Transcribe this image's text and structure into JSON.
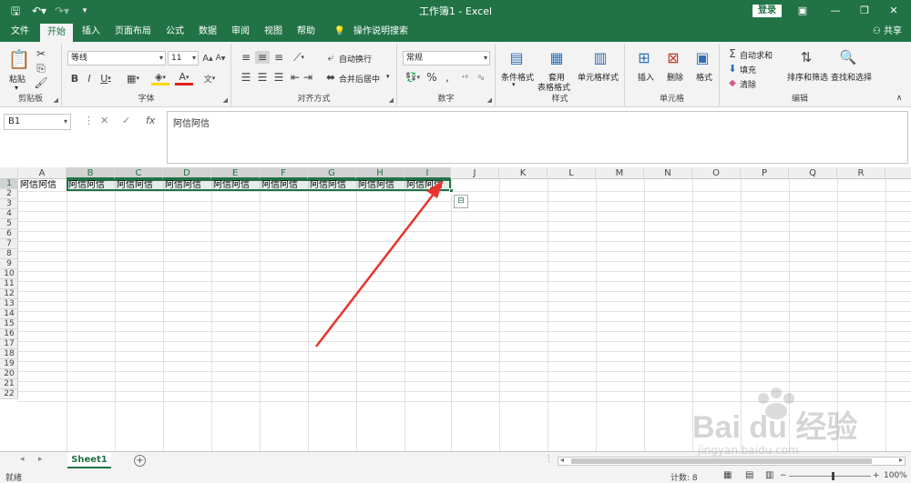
{
  "window": {
    "title": "工作簿1  -  Excel",
    "login_label": "登录"
  },
  "menu": {
    "tabs": [
      "文件",
      "开始",
      "插入",
      "页面布局",
      "公式",
      "数据",
      "审阅",
      "视图",
      "帮助"
    ],
    "tell_me": "操作说明搜索",
    "share": "共享"
  },
  "ribbon": {
    "clipboard": {
      "label": "剪贴板",
      "paste": "粘贴"
    },
    "font": {
      "label": "字体",
      "font_name": "等线",
      "font_size": "11"
    },
    "alignment": {
      "label": "对齐方式",
      "wrap": "自动换行",
      "merge": "合并后居中"
    },
    "number": {
      "label": "数字",
      "format": "常规"
    },
    "styles": {
      "label": "样式",
      "conditional": "条件格式",
      "table_line1": "套用",
      "table_line2": "表格格式",
      "cell_styles": "单元格样式"
    },
    "cells": {
      "label": "单元格",
      "insert": "插入",
      "delete": "删除",
      "format": "格式"
    },
    "editing": {
      "label": "编辑",
      "autosum": "自动求和",
      "fill": "填充",
      "clear": "清除",
      "sort": "排序和筛选",
      "find": "查找和选择"
    }
  },
  "formula_bar": {
    "name_box": "B1",
    "formula": "阿信阿信"
  },
  "grid": {
    "columns": [
      "A",
      "B",
      "C",
      "D",
      "E",
      "F",
      "G",
      "H",
      "I",
      "J",
      "K",
      "L",
      "M",
      "N",
      "O",
      "P",
      "Q",
      "R"
    ],
    "rows": [
      "1",
      "2",
      "3",
      "4",
      "5",
      "6",
      "7",
      "8",
      "9",
      "10",
      "11",
      "12",
      "13",
      "14",
      "15",
      "16",
      "17",
      "18",
      "19",
      "20",
      "21",
      "22"
    ],
    "row1_values": [
      "阿信阿信",
      "阿信阿信",
      "阿信阿信",
      "阿信阿信",
      "阿信阿信",
      "阿信阿信",
      "阿信阿信",
      "阿信阿信",
      "阿信阿信"
    ]
  },
  "sheets": {
    "active": "Sheet1"
  },
  "status": {
    "ready": "就绪",
    "count": "计数: 8",
    "zoom": "100%"
  },
  "watermark": {
    "brand": "Bai du 经验",
    "url": "jingyan.baidu.com"
  },
  "colors": {
    "accent": "#217346",
    "arrow": "#e8342e"
  }
}
